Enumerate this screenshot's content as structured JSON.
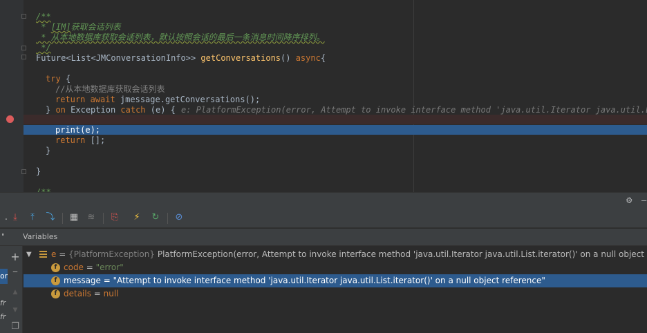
{
  "editor": {
    "lines": [
      {
        "id": "doc-open",
        "text": "/**"
      },
      {
        "id": "doc-1-prefix",
        "text": " * "
      },
      {
        "id": "doc-1-tag",
        "text": "[IM]"
      },
      {
        "id": "doc-1-rest",
        "text": "获取会话列表"
      },
      {
        "id": "doc-2",
        "text": " * 从本地数据库获取会话列表，默认按照会话的最后一条消息时间降序排列。"
      },
      {
        "id": "doc-close",
        "text": " */"
      },
      {
        "id": "sig-type",
        "text": "Future<List<JMConversationInfo>> "
      },
      {
        "id": "sig-fn",
        "text": "getConversations"
      },
      {
        "id": "sig-parens",
        "text": "() "
      },
      {
        "id": "sig-async",
        "text": "async"
      },
      {
        "id": "sig-brace",
        "text": "{"
      },
      {
        "id": "try-kw",
        "text": "try"
      },
      {
        "id": "try-brace",
        "text": " {"
      },
      {
        "id": "comment",
        "text": "//从本地数据库获取会话列表"
      },
      {
        "id": "ret-kw",
        "text": "return await "
      },
      {
        "id": "ret-expr",
        "text": "jmessage.getConversations();"
      },
      {
        "id": "catch-close",
        "text": "} "
      },
      {
        "id": "catch-on",
        "text": "on "
      },
      {
        "id": "catch-type",
        "text": "Exception "
      },
      {
        "id": "catch-kw",
        "text": "catch "
      },
      {
        "id": "catch-args",
        "text": "(e) {"
      },
      {
        "id": "catch-hint",
        "text": "e: PlatformException(error, Attempt to invoke interface method 'java.util.Iterator java.util.List.iterator()' on a null object reference"
      },
      {
        "id": "print",
        "text": "print(e);"
      },
      {
        "id": "ret2-kw",
        "text": "return "
      },
      {
        "id": "ret2-val",
        "text": "[];"
      },
      {
        "id": "inner-close",
        "text": "}"
      },
      {
        "id": "outer-close",
        "text": "}"
      },
      {
        "id": "next-doc",
        "text": "/**"
      }
    ]
  },
  "debug": {
    "variables_title": "Variables",
    "frames": {
      "selected_label": "on",
      "items": [
        "fr",
        "fr"
      ]
    },
    "variables": [
      {
        "name": "e",
        "eq": " = ",
        "type": "{PlatformException} ",
        "value": "PlatformException(error, Attempt to invoke interface method 'java.util.Iterator java.util.List.iterator()' on a null object reference)"
      },
      {
        "name": "code",
        "eq": " = ",
        "value": "\"error\""
      },
      {
        "name": "message",
        "eq": " = ",
        "value": "\"Attempt to invoke interface method 'java.util.Iterator java.util.List.iterator()' on a null object reference\""
      },
      {
        "name": "details",
        "eq": " = ",
        "value": "null"
      }
    ],
    "badge_letter": "f"
  },
  "icons": {
    "gear": "⚙",
    "add": "+",
    "minus": "–",
    "up": "▲",
    "down": "▼",
    "copy": "❐"
  },
  "colors": {
    "selection": "#2d5b8e",
    "breakpoint": "#db5c5c",
    "keyword": "#cc7832",
    "function": "#ffc66d",
    "doc": "#629755"
  }
}
